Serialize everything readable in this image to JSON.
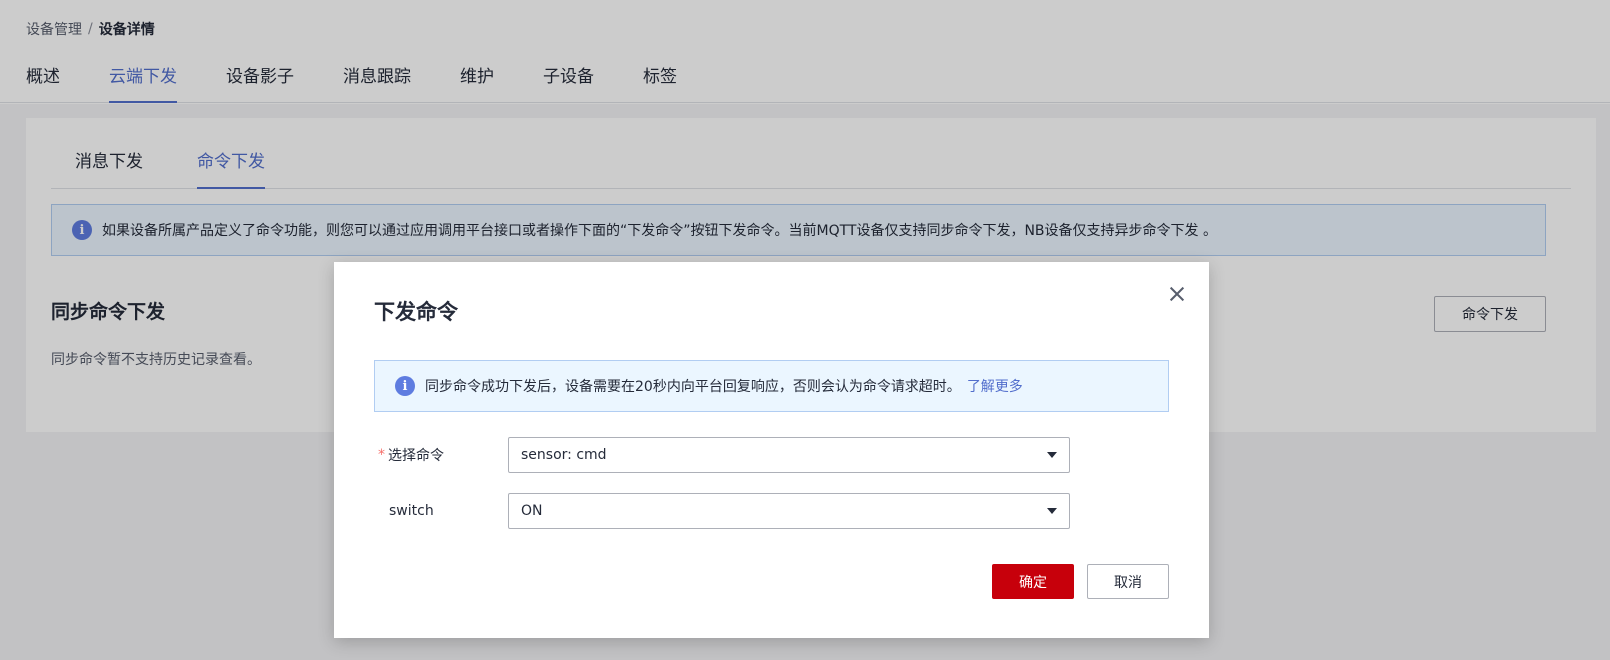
{
  "breadcrumb": {
    "parent": "设备管理",
    "separator": "/",
    "current": "设备详情"
  },
  "main_tabs": [
    {
      "label": "概述",
      "active": false
    },
    {
      "label": "云端下发",
      "active": true
    },
    {
      "label": "设备影子",
      "active": false
    },
    {
      "label": "消息跟踪",
      "active": false
    },
    {
      "label": "维护",
      "active": false
    },
    {
      "label": "子设备",
      "active": false
    },
    {
      "label": "标签",
      "active": false
    }
  ],
  "sub_tabs": [
    {
      "label": "消息下发",
      "active": false
    },
    {
      "label": "命令下发",
      "active": true
    }
  ],
  "info_banner": {
    "icon": "info-icon",
    "text": "如果设备所属产品定义了命令功能，则您可以通过应用调用平台接口或者操作下面的“下发命令”按钮下发命令。当前MQTT设备仅支持同步命令下发，NB设备仅支持异步命令下发 。"
  },
  "sync_section": {
    "title": "同步命令下发",
    "description": "同步命令暂不支持历史记录查看。",
    "button_label": "命令下发"
  },
  "dialog": {
    "title": "下发命令",
    "close_icon": "close-icon",
    "info_text": "同步命令成功下发后，设备需要在20秒内向平台回复响应，否则会认为命令请求超时。",
    "info_link": "了解更多",
    "fields": {
      "command": {
        "required_mark": "*",
        "label": "选择命令",
        "value": "sensor: cmd"
      },
      "switch": {
        "label": "switch",
        "value": "ON"
      }
    },
    "confirm_label": "确定",
    "cancel_label": "取消"
  },
  "colors": {
    "accent": "#526ecc",
    "primary_button": "#c7000b",
    "info_background": "#ebf6ff",
    "info_border": "#b1cdf2",
    "required": "#f66f6a"
  }
}
